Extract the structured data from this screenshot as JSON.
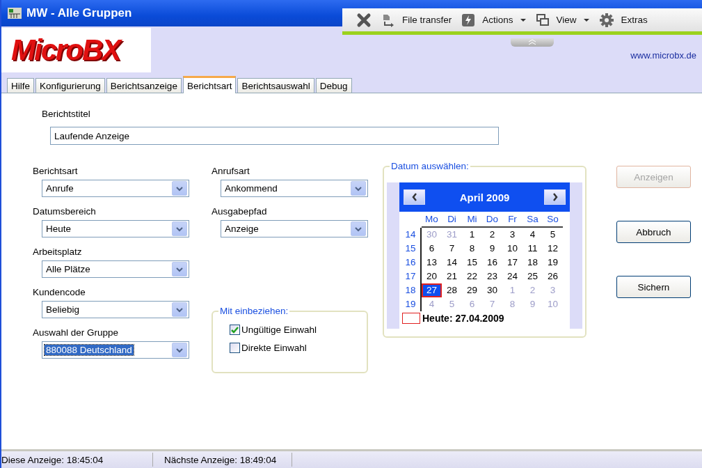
{
  "window": {
    "title": "MW - Alle Gruppen"
  },
  "toolbar": {
    "items": [
      {
        "kind": "close"
      },
      {
        "kind": "transfer",
        "label": "File transfer"
      },
      {
        "kind": "actions",
        "label": "Actions",
        "menu": true
      },
      {
        "kind": "view",
        "label": "View",
        "menu": true
      },
      {
        "kind": "gear",
        "label": "Extras"
      }
    ]
  },
  "header": {
    "logo": "MicroBX",
    "link": "www.microbx.de"
  },
  "tabs": [
    {
      "label": "Hilfe",
      "selected": false
    },
    {
      "label": "Konfigurierung",
      "selected": false
    },
    {
      "label": "Berichtsanzeige",
      "selected": false
    },
    {
      "label": "Berichtsart",
      "selected": true
    },
    {
      "label": "Berichtsauswahl",
      "selected": false
    },
    {
      "label": "Debug",
      "selected": false
    }
  ],
  "report_title": {
    "label": "Berichtstitel",
    "value": "Laufende Anzeige"
  },
  "left_fields": [
    {
      "label": "Berichtsart",
      "value": "Anrufe",
      "highlighted": false
    },
    {
      "label": "Datumsbereich",
      "value": "Heute",
      "highlighted": false
    },
    {
      "label": "Arbeitsplatz",
      "value": "Alle Plätze",
      "highlighted": false
    },
    {
      "label": "Kundencode",
      "value": "Beliebig",
      "highlighted": false
    },
    {
      "label": "Auswahl der Gruppe",
      "value": "880088 Deutschland",
      "highlighted": true
    }
  ],
  "middle_fields": [
    {
      "label": "Anrufsart",
      "value": "Ankommend",
      "highlighted": false
    },
    {
      "label": "Ausgabepfad",
      "value": "Anzeige",
      "highlighted": false
    }
  ],
  "include_group": {
    "legend": "Mit einbeziehen:",
    "options": [
      {
        "label": "Ungültige Einwahl",
        "checked": true
      },
      {
        "label": "Direkte Einwahl",
        "checked": false
      }
    ]
  },
  "calendar": {
    "legend": "Datum auswählen:",
    "month": "April 2009",
    "weekdays": [
      "Mo",
      "Di",
      "Mi",
      "Do",
      "Fr",
      "Sa",
      "So"
    ],
    "weeks": [
      {
        "week": "14",
        "days": [
          {
            "day": "30",
            "other_month": true,
            "selected": false
          },
          {
            "day": "31",
            "other_month": true,
            "selected": false
          },
          {
            "day": "1",
            "other_month": false,
            "selected": false
          },
          {
            "day": "2",
            "other_month": false,
            "selected": false
          },
          {
            "day": "3",
            "other_month": false,
            "selected": false
          },
          {
            "day": "4",
            "other_month": false,
            "selected": false
          },
          {
            "day": "5",
            "other_month": false,
            "selected": false
          }
        ]
      },
      {
        "week": "15",
        "days": [
          {
            "day": "6",
            "other_month": false,
            "selected": false
          },
          {
            "day": "7",
            "other_month": false,
            "selected": false
          },
          {
            "day": "8",
            "other_month": false,
            "selected": false
          },
          {
            "day": "9",
            "other_month": false,
            "selected": false
          },
          {
            "day": "10",
            "other_month": false,
            "selected": false
          },
          {
            "day": "11",
            "other_month": false,
            "selected": false
          },
          {
            "day": "12",
            "other_month": false,
            "selected": false
          }
        ]
      },
      {
        "week": "16",
        "days": [
          {
            "day": "13",
            "other_month": false,
            "selected": false
          },
          {
            "day": "14",
            "other_month": false,
            "selected": false
          },
          {
            "day": "15",
            "other_month": false,
            "selected": false
          },
          {
            "day": "16",
            "other_month": false,
            "selected": false
          },
          {
            "day": "17",
            "other_month": false,
            "selected": false
          },
          {
            "day": "18",
            "other_month": false,
            "selected": false
          },
          {
            "day": "19",
            "other_month": false,
            "selected": false
          }
        ]
      },
      {
        "week": "17",
        "days": [
          {
            "day": "20",
            "other_month": false,
            "selected": false
          },
          {
            "day": "21",
            "other_month": false,
            "selected": false
          },
          {
            "day": "22",
            "other_month": false,
            "selected": false
          },
          {
            "day": "23",
            "other_month": false,
            "selected": false
          },
          {
            "day": "24",
            "other_month": false,
            "selected": false
          },
          {
            "day": "25",
            "other_month": false,
            "selected": false
          },
          {
            "day": "26",
            "other_month": false,
            "selected": false
          }
        ]
      },
      {
        "week": "18",
        "days": [
          {
            "day": "27",
            "other_month": false,
            "selected": true
          },
          {
            "day": "28",
            "other_month": false,
            "selected": false
          },
          {
            "day": "29",
            "other_month": false,
            "selected": false
          },
          {
            "day": "30",
            "other_month": false,
            "selected": false
          },
          {
            "day": "1",
            "other_month": true,
            "selected": false
          },
          {
            "day": "2",
            "other_month": true,
            "selected": false
          },
          {
            "day": "3",
            "other_month": true,
            "selected": false
          }
        ]
      },
      {
        "week": "19",
        "days": [
          {
            "day": "4",
            "other_month": true,
            "selected": false
          },
          {
            "day": "5",
            "other_month": true,
            "selected": false
          },
          {
            "day": "6",
            "other_month": true,
            "selected": false
          },
          {
            "day": "7",
            "other_month": true,
            "selected": false
          },
          {
            "day": "8",
            "other_month": true,
            "selected": false
          },
          {
            "day": "9",
            "other_month": true,
            "selected": false
          },
          {
            "day": "10",
            "other_month": true,
            "selected": false
          }
        ]
      }
    ],
    "today": "Heute: 27.04.2009"
  },
  "buttons": [
    {
      "label": "Anzeigen",
      "disabled": true
    },
    {
      "label": "Abbruch",
      "disabled": false
    },
    {
      "label": "Sichern",
      "disabled": false
    }
  ],
  "status_bar": [
    "Diese Anzeige: 18:45:04",
    "Nächste Anzeige: 18:49:04"
  ]
}
